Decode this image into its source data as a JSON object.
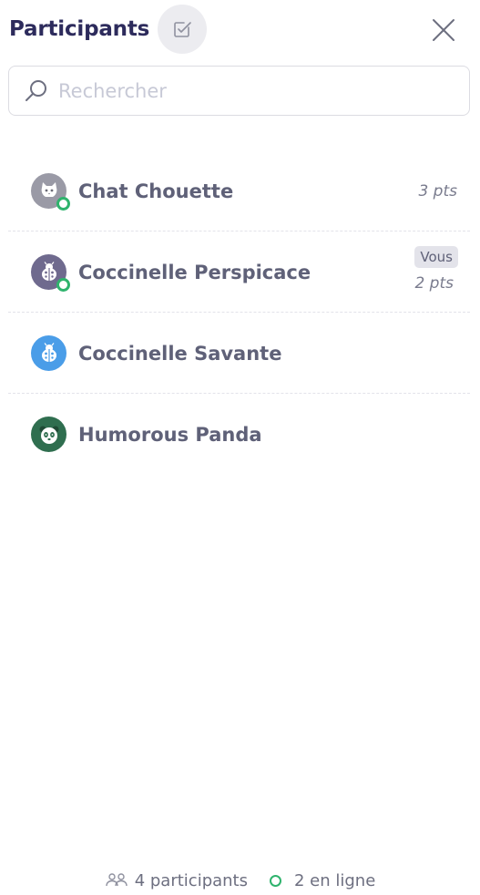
{
  "header": {
    "title": "Participants"
  },
  "search": {
    "placeholder": "Rechercher"
  },
  "participants": [
    {
      "name": "Chat Chouette",
      "points": "3 pts",
      "online": true,
      "avatar": "cat-icon",
      "avatar_color": "#9a9aa6"
    },
    {
      "name": "Coccinelle Perspicace",
      "points": "2 pts",
      "badge": "Vous",
      "online": true,
      "avatar": "ladybug-icon",
      "avatar_color": "#6f6a8e"
    },
    {
      "name": "Coccinelle Savante",
      "online": false,
      "avatar": "ladybug-icon",
      "avatar_color": "#4a9de8"
    },
    {
      "name": "Humorous Panda",
      "online": false,
      "avatar": "panda-icon",
      "avatar_color": "#2f6e4f"
    }
  ],
  "footer": {
    "participants_count": "4 participants",
    "online_count": "2 en ligne"
  },
  "colors": {
    "title": "#2d2b5c",
    "online": "#2fb36d",
    "text": "#5f6178"
  }
}
